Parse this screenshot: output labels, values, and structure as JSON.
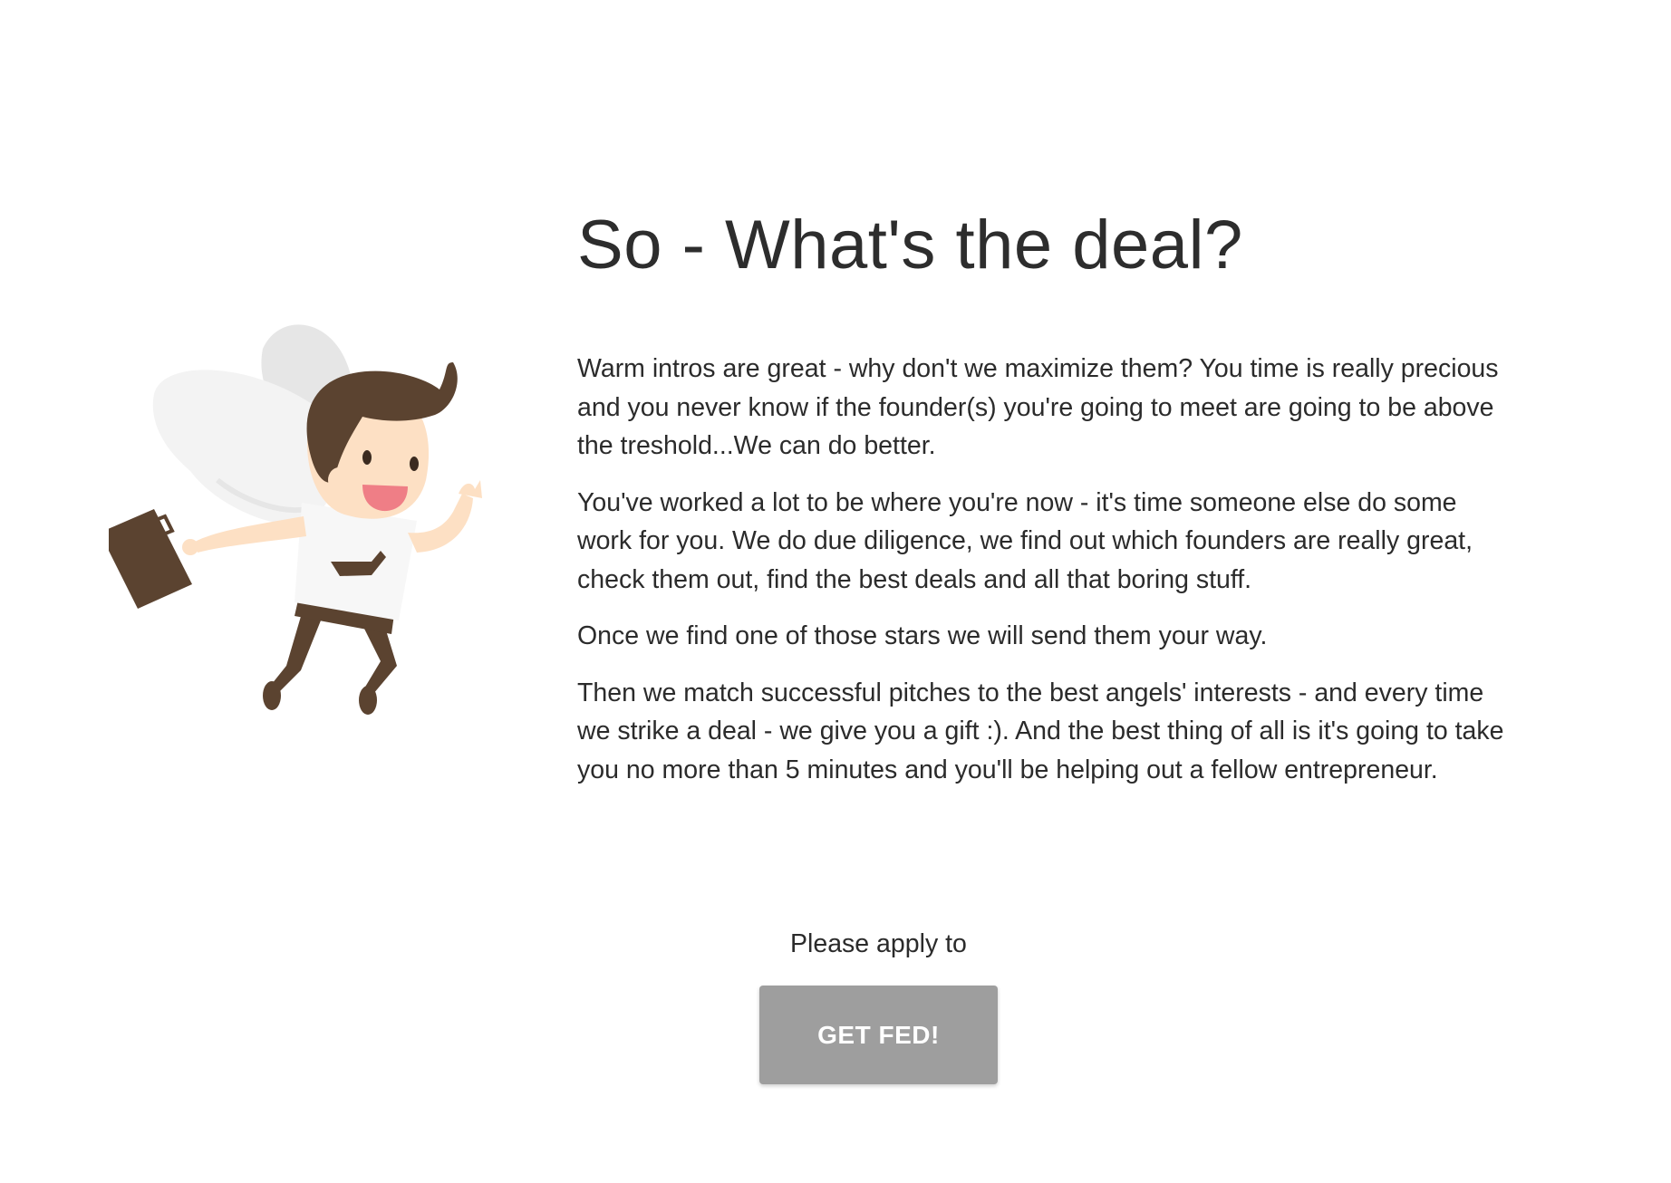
{
  "main": {
    "title": "So - What's the deal?",
    "paragraphs": [
      "Warm intros are great - why don't we maximize them? You time is really precious and you never know if the founder(s) you're going to meet are going to be above the treshold...We can do better.",
      "You've worked a lot to be where you're now - it's time someone else do some work for you. We do due diligence, we find out which founders are really great, check them out, find the best deals and all that boring stuff.",
      "Once we find one of those stars we will send them your way.",
      "Then we match successful pitches to the best angels' interests - and every time we strike a deal - we give you a gift :). And the best thing of all is it's going to take you no more than 5 minutes and you'll be helping out a fellow entrepreneur."
    ]
  },
  "cta": {
    "text": "Please apply to",
    "button_label": "GET FED!"
  },
  "illustration": {
    "icon": "angel-businessman-icon"
  },
  "colors": {
    "button_bg": "#9e9e9e",
    "hair_brown": "#5b4330",
    "skin": "#fde0c4",
    "wing": "#eeeeee"
  }
}
